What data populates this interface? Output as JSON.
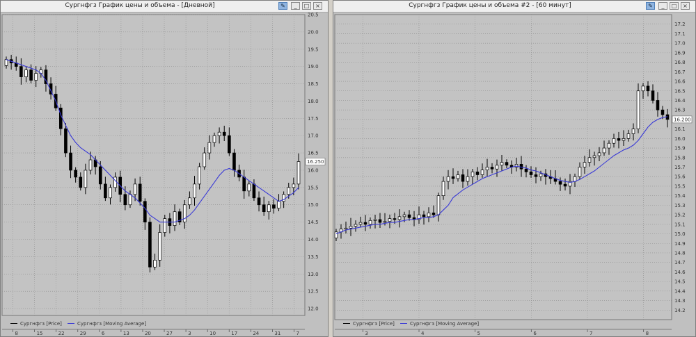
{
  "windows": [
    {
      "title": "Сургнфгз График цены и объема - [Дневной]",
      "legend": [
        "Сургнфгз [Price]",
        "Сургнфгз [Moving Average]"
      ],
      "price_label": "16.250"
    },
    {
      "title": "Сургнфгз График цены и объема #2 - [60 минут]",
      "legend": [
        "Сургнфгз [Price]",
        "Сургнфгз [Moving Average]"
      ],
      "price_label": "16.200"
    }
  ],
  "buttons": {
    "pin": "✎",
    "minimize": "_",
    "maximize": "□",
    "close": "×"
  },
  "colors": {
    "plot_bg": "#c3c3c3",
    "grid": "#8e8e8e",
    "candle": "#000000",
    "ma": "#3a3ad6",
    "price_label_bg": "#ffffff"
  },
  "chart_data": [
    {
      "type": "candlestick",
      "timeframe": "Дневной",
      "ylim": [
        11.8,
        20.5
      ],
      "y_ticks": [
        12.0,
        12.5,
        13.0,
        13.5,
        14.0,
        14.5,
        15.0,
        15.5,
        16.0,
        16.5,
        17.0,
        17.5,
        18.0,
        18.5,
        19.0,
        19.5,
        20.0,
        20.5
      ],
      "x_ticks": [
        "8",
        "15",
        "22",
        "29",
        "6",
        "13",
        "20",
        "27",
        "3",
        "10",
        "17",
        "24",
        "31",
        "7"
      ],
      "price_label": 16.25,
      "close": [
        19.2,
        19.1,
        19.0,
        18.7,
        18.9,
        18.6,
        18.8,
        18.9,
        18.5,
        18.2,
        17.8,
        17.2,
        16.5,
        16.0,
        15.8,
        15.5,
        16.0,
        16.3,
        16.1,
        15.6,
        15.2,
        15.5,
        15.8,
        15.3,
        15.0,
        15.3,
        15.6,
        15.1,
        14.5,
        13.2,
        13.4,
        14.2,
        14.6,
        14.4,
        14.8,
        14.5,
        15.0,
        15.2,
        15.6,
        16.1,
        16.5,
        16.8,
        17.0,
        17.1,
        17.0,
        16.5,
        16.0,
        15.8,
        15.4,
        15.6,
        15.2,
        15.0,
        14.8,
        15.0,
        14.9,
        15.1,
        15.3,
        15.5,
        15.6,
        16.25
      ],
      "ma": [
        19.2,
        19.15,
        19.1,
        19.05,
        19.0,
        18.95,
        18.9,
        18.8,
        18.6,
        18.3,
        18.0,
        17.6,
        17.3,
        17.0,
        16.8,
        16.65,
        16.55,
        16.45,
        16.3,
        16.15,
        16.0,
        15.85,
        15.7,
        15.55,
        15.4,
        15.3,
        15.2,
        15.05,
        14.9,
        14.7,
        14.6,
        14.5,
        14.5,
        14.5,
        14.5,
        14.55,
        14.6,
        14.7,
        14.85,
        15.05,
        15.25,
        15.45,
        15.65,
        15.85,
        16.0,
        16.05,
        16.0,
        15.9,
        15.8,
        15.7,
        15.6,
        15.5,
        15.4,
        15.3,
        15.2,
        15.1,
        15.15,
        15.25,
        15.35,
        15.5
      ]
    },
    {
      "type": "candlestick",
      "timeframe": "60 минут",
      "ylim": [
        14.1,
        17.3
      ],
      "y_ticks": [
        14.2,
        14.3,
        14.4,
        14.5,
        14.6,
        14.7,
        14.8,
        14.9,
        15.0,
        15.1,
        15.2,
        15.3,
        15.4,
        15.5,
        15.6,
        15.7,
        15.8,
        15.9,
        16.0,
        16.1,
        16.2,
        16.3,
        16.4,
        16.5,
        16.6,
        16.7,
        16.8,
        16.9,
        17.0,
        17.1,
        17.2
      ],
      "x_ticks": [
        "3",
        "4",
        "5",
        "6",
        "7",
        "8"
      ],
      "price_label": 16.2,
      "close": [
        15.02,
        15.05,
        15.06,
        15.08,
        15.1,
        15.12,
        15.1,
        15.14,
        15.15,
        15.12,
        15.13,
        15.16,
        15.15,
        15.18,
        15.2,
        15.17,
        15.15,
        15.2,
        15.18,
        15.22,
        15.2,
        15.4,
        15.55,
        15.6,
        15.58,
        15.62,
        15.55,
        15.6,
        15.65,
        15.62,
        15.67,
        15.7,
        15.68,
        15.72,
        15.75,
        15.72,
        15.7,
        15.73,
        15.68,
        15.65,
        15.62,
        15.6,
        15.63,
        15.6,
        15.58,
        15.55,
        15.52,
        15.5,
        15.55,
        15.6,
        15.7,
        15.75,
        15.8,
        15.82,
        15.85,
        15.9,
        15.95,
        16.0,
        15.98,
        16.0,
        16.05,
        16.1,
        16.5,
        16.55,
        16.5,
        16.4,
        16.3,
        16.25,
        16.2
      ],
      "ma": [
        15.0,
        15.02,
        15.04,
        15.05,
        15.06,
        15.07,
        15.08,
        15.09,
        15.1,
        15.1,
        15.11,
        15.12,
        15.12,
        15.13,
        15.14,
        15.15,
        15.15,
        15.16,
        15.17,
        15.17,
        15.18,
        15.2,
        15.25,
        15.3,
        15.38,
        15.42,
        15.46,
        15.49,
        15.52,
        15.55,
        15.58,
        15.6,
        15.62,
        15.64,
        15.66,
        15.68,
        15.7,
        15.71,
        15.7,
        15.69,
        15.67,
        15.66,
        15.64,
        15.62,
        15.6,
        15.58,
        15.56,
        15.55,
        15.54,
        15.55,
        15.57,
        15.6,
        15.63,
        15.66,
        15.7,
        15.74,
        15.78,
        15.82,
        15.85,
        15.88,
        15.9,
        15.93,
        15.98,
        16.05,
        16.12,
        16.17,
        16.2,
        16.22,
        16.23
      ]
    }
  ]
}
